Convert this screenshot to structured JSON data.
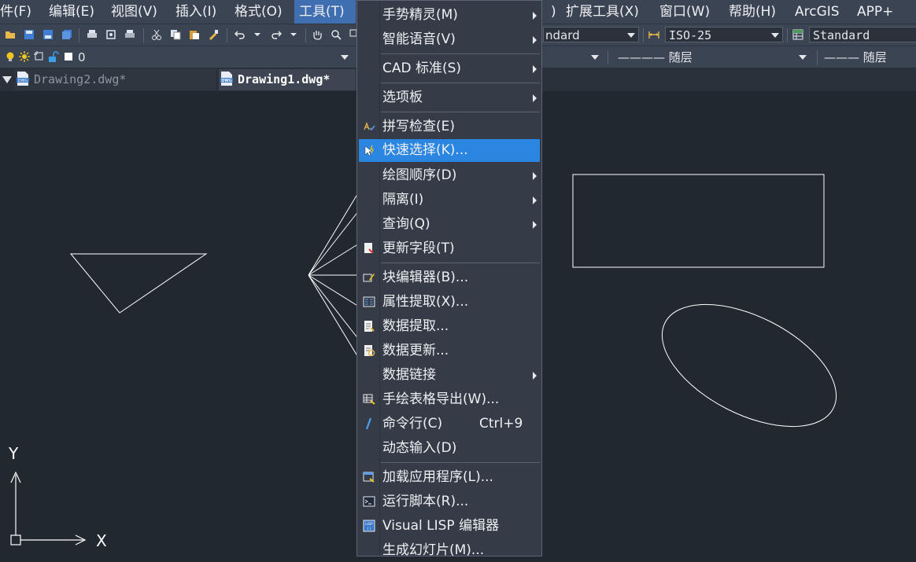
{
  "menubar": {
    "items": [
      "件(F)",
      "编辑(E)",
      "视图(V)",
      "插入(I)",
      "格式(O)",
      "工具(T)",
      ")",
      "扩展工具(X)",
      "窗口(W)",
      "帮助(H)",
      "ArcGIS",
      "APP+"
    ]
  },
  "toolbar": {
    "textstyle_value": "ndard",
    "dimstyle_value": "ISO-25",
    "tablestyle_value": "Standard",
    "layer_value": "0",
    "linetype_value": "———— 随层",
    "lineweight_value": "——— 随层"
  },
  "tabs": [
    {
      "label": "Drawing2.dwg*",
      "active": false
    },
    {
      "label": "Drawing1.dwg*",
      "active": true
    }
  ],
  "tools_menu": {
    "items": [
      {
        "label": "手势精灵(M)",
        "submenu": true
      },
      {
        "label": "智能语音(V)",
        "submenu": true
      },
      {
        "label": "CAD 标准(S)",
        "submenu": true
      },
      {
        "label": "选项板",
        "submenu": true
      },
      {
        "label": "拼写检查(E)",
        "icon": "spellcheck-icon"
      },
      {
        "label": "快速选择(K)...",
        "icon": "quick-select-icon",
        "highlighted": true
      },
      {
        "label": "绘图顺序(D)",
        "submenu": true
      },
      {
        "label": "隔离(I)",
        "submenu": true
      },
      {
        "label": "查询(Q)",
        "submenu": true
      },
      {
        "label": "更新字段(T)",
        "icon": "update-field-icon"
      },
      {
        "label": "块编辑器(B)...",
        "icon": "block-editor-icon"
      },
      {
        "label": "属性提取(X)...",
        "icon": "attribute-extract-icon"
      },
      {
        "label": "数据提取...",
        "icon": "data-extract-icon"
      },
      {
        "label": "数据更新...",
        "icon": "data-update-icon"
      },
      {
        "label": "数据链接",
        "submenu": true
      },
      {
        "label": "手绘表格导出(W)...",
        "icon": "table-export-icon"
      },
      {
        "label": "命令行(C)",
        "icon": "checkmark-icon",
        "shortcut": "Ctrl+9"
      },
      {
        "label": "动态输入(D)"
      },
      {
        "label": "加载应用程序(L)...",
        "icon": "load-app-icon"
      },
      {
        "label": "运行脚本(R)...",
        "icon": "run-script-icon"
      },
      {
        "label": "Visual LISP 编辑器",
        "icon": "lisp-editor-icon"
      },
      {
        "label": "生成幻灯片(M)..."
      }
    ]
  },
  "ucs": {
    "x_label": "X",
    "y_label": "Y"
  },
  "colors": {
    "menubar_bg": "#3b4452",
    "canvas_bg": "#212830",
    "menu_bg": "#353c47",
    "menu_highlight": "#2a86e0",
    "active_menu": "#3f6fb0",
    "drawing_line": "#ffffff"
  }
}
